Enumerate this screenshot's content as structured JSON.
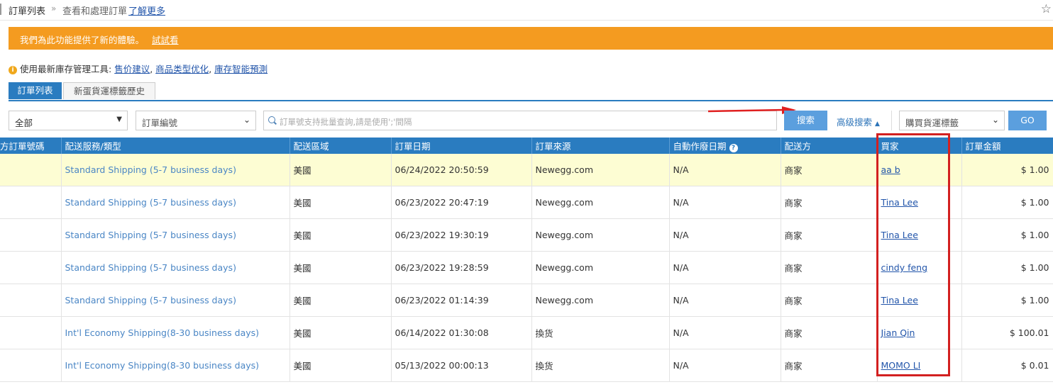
{
  "breadcrumb": {
    "title": "訂單列表",
    "separator": "»",
    "subtitle": "查看和處理訂單",
    "link": "了解更多"
  },
  "banner": {
    "message": "我們為此功能提供了新的體驗。",
    "try_link": "試試看",
    "color": "#f49b20"
  },
  "tools": {
    "prefix": "使用最新庫存管理工具:",
    "links": [
      "售价建议",
      "商品类型优化",
      "庫存智能預測"
    ],
    "separator": ", "
  },
  "tabs": [
    {
      "label": "訂單列表",
      "active": true
    },
    {
      "label": "新蛋貨運標籤歷史",
      "active": false
    }
  ],
  "filters": {
    "status_value": "全部",
    "field_value": "訂單編號",
    "search_placeholder": "訂單號支持批量查詢,請是使用';'間隔",
    "search_button": "搜索",
    "advanced_search": "高级搜索",
    "label_select": "購買貨運標籤",
    "go_button": "GO"
  },
  "table": {
    "headers": [
      "方訂單號碼",
      "配送服務/類型",
      "配送區域",
      "訂單日期",
      "訂單來源",
      "自動作廢日期",
      "配送方",
      "買家",
      "訂單金額"
    ],
    "rows": [
      {
        "order_no": "",
        "service": "Standard Shipping (5-7 business days)",
        "region": "美國",
        "date": "06/24/2022 20:50:59",
        "source": "Newegg.com",
        "void_date": "N/A",
        "shipper": "商家",
        "buyer": "aa b",
        "amount": "$ 1.00",
        "highlighted": true
      },
      {
        "order_no": "",
        "service": "Standard Shipping (5-7 business days)",
        "region": "美國",
        "date": "06/23/2022 20:47:19",
        "source": "Newegg.com",
        "void_date": "N/A",
        "shipper": "商家",
        "buyer": "Tina Lee",
        "amount": "$ 1.00",
        "highlighted": false
      },
      {
        "order_no": "",
        "service": "Standard Shipping (5-7 business days)",
        "region": "美國",
        "date": "06/23/2022 19:30:19",
        "source": "Newegg.com",
        "void_date": "N/A",
        "shipper": "商家",
        "buyer": "Tina Lee",
        "amount": "$ 1.00",
        "highlighted": false
      },
      {
        "order_no": "",
        "service": "Standard Shipping (5-7 business days)",
        "region": "美國",
        "date": "06/23/2022 19:28:59",
        "source": "Newegg.com",
        "void_date": "N/A",
        "shipper": "商家",
        "buyer": "cindy feng",
        "amount": "$ 1.00",
        "highlighted": false
      },
      {
        "order_no": "",
        "service": "Standard Shipping (5-7 business days)",
        "region": "美國",
        "date": "06/23/2022 01:14:39",
        "source": "Newegg.com",
        "void_date": "N/A",
        "shipper": "商家",
        "buyer": "Tina Lee",
        "amount": "$ 1.00",
        "highlighted": false
      },
      {
        "order_no": "",
        "service": "Int'l Economy Shipping(8-30 business days)",
        "region": "美國",
        "date": "06/14/2022 01:30:08",
        "source": "換货",
        "void_date": "N/A",
        "shipper": "商家",
        "buyer": "Jian Qin",
        "amount": "$ 100.01",
        "highlighted": false
      },
      {
        "order_no": "",
        "service": "Int'l Economy Shipping(8-30 business days)",
        "region": "美國",
        "date": "05/13/2022 00:00:13",
        "source": "換货",
        "void_date": "N/A",
        "shipper": "商家",
        "buyer": "MOMO LI",
        "amount": "$ 0.01",
        "highlighted": false
      }
    ]
  },
  "colors": {
    "header_blue": "#2a7cc0",
    "button_blue": "#5b9fde",
    "highlight_row": "#fdfdd3",
    "annotation_red": "#d32020"
  }
}
